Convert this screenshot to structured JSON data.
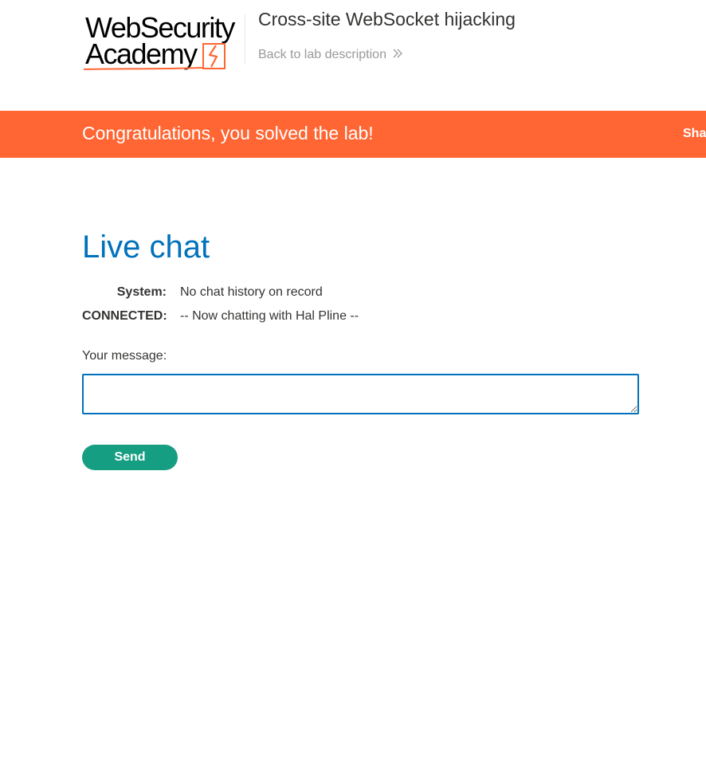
{
  "header": {
    "logo_line1": "WebSecurity",
    "logo_line2": "Academy",
    "lab_title": "Cross-site WebSocket hijacking",
    "back_link": "Back to lab description",
    "back_icon": "double-chevron-right-icon"
  },
  "banner": {
    "message": "Congratulations, you solved the lab!",
    "share_label": "Sha",
    "color": "#ff6633"
  },
  "main": {
    "title": "Live chat",
    "chat": [
      {
        "user": "System:",
        "message": "No chat history on record"
      },
      {
        "user": "CONNECTED:",
        "message": "-- Now chatting with Hal Pline --"
      }
    ],
    "message_label": "Your message:",
    "message_value": "",
    "send_label": "Send"
  },
  "colors": {
    "accent_blue": "#0071bc",
    "send_green": "#169e82",
    "banner_orange": "#ff6633"
  }
}
